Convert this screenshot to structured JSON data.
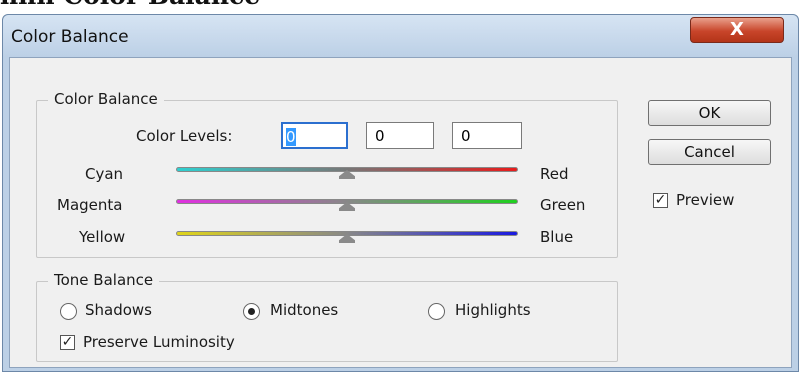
{
  "page_heading": "nnn Color Balance",
  "window": {
    "title": "Color Balance",
    "close_glyph": "X"
  },
  "color_balance": {
    "group_label": "Color Balance",
    "levels_label": "Color Levels:",
    "levels": [
      "0",
      "0",
      "0"
    ],
    "sliders": [
      {
        "left": "Cyan",
        "right": "Red",
        "value": 0
      },
      {
        "left": "Magenta",
        "right": "Green",
        "value": 0
      },
      {
        "left": "Yellow",
        "right": "Blue",
        "value": 0
      }
    ]
  },
  "tone_balance": {
    "group_label": "Tone Balance",
    "options": [
      "Shadows",
      "Midtones",
      "Highlights"
    ],
    "selected": "Midtones",
    "preserve_label": "Preserve Luminosity",
    "preserve_checked": true
  },
  "buttons": {
    "ok": "OK",
    "cancel": "Cancel"
  },
  "preview": {
    "label": "Preview",
    "checked": true
  },
  "check_glyph": "✓",
  "colors": {
    "title_bar": "#bcd0e6",
    "close_button": "#c8452a",
    "dialog_bg": "#f0f0f0",
    "focus_border": "#2b6fcf"
  }
}
